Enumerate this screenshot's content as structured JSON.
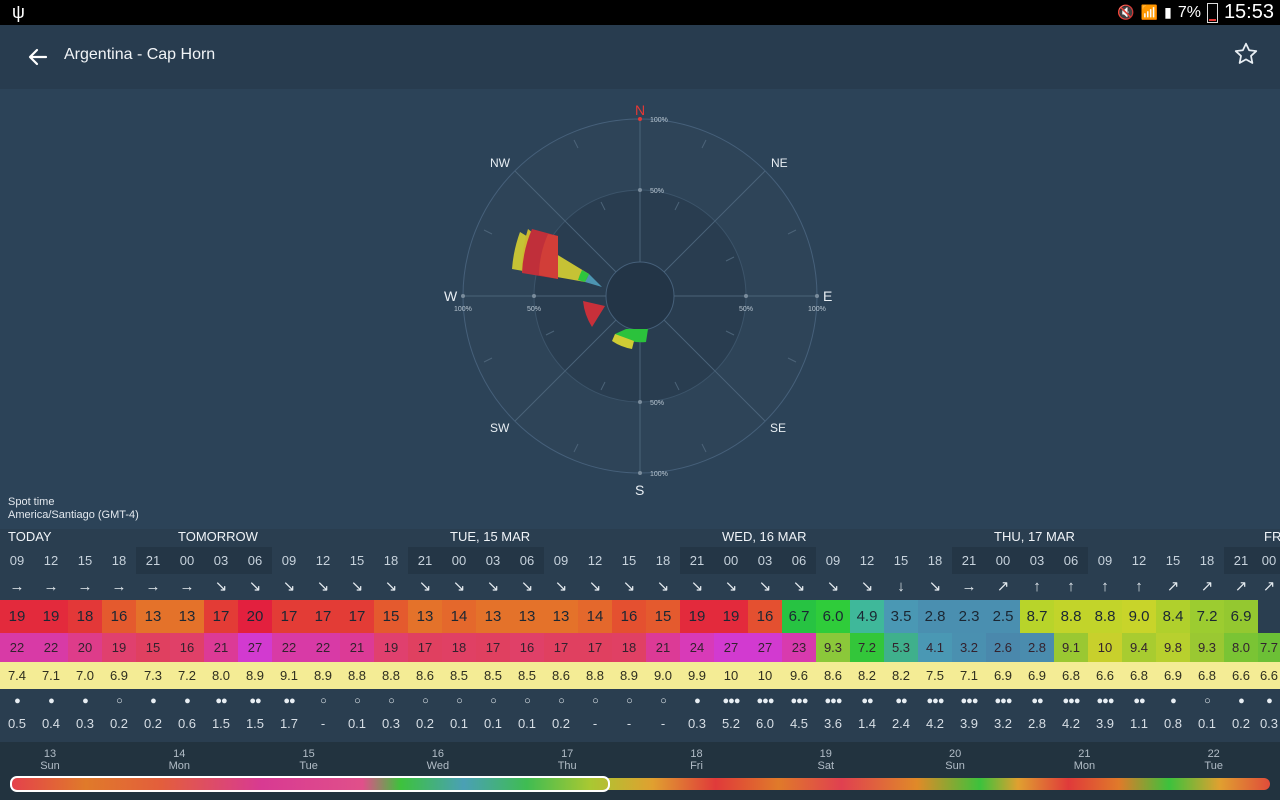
{
  "status_bar": {
    "usb_icon": "usb-icon",
    "battery_percent": "7%",
    "time": "15:53"
  },
  "app_bar": {
    "back_icon": "arrow-back-icon",
    "title": "Argentina - Cap Horn",
    "favorite_icon": "star-outline-icon"
  },
  "wind_rose": {
    "directions": [
      "N",
      "NE",
      "E",
      "SE",
      "S",
      "SW",
      "W",
      "NW"
    ],
    "ring_labels": [
      "100%",
      "50%"
    ],
    "colors": {
      "north": "#e53935",
      "ring": "#3a5268",
      "inner": "#2a3f53"
    }
  },
  "spot_time": {
    "label": "Spot time",
    "zone": "America/Santiago (GMT-4)"
  },
  "forecast": {
    "day_labels": [
      "TODAY",
      "TOMORROW",
      "TUE, 15 MAR",
      "WED, 16 MAR",
      "THU, 17 MAR",
      "FR"
    ],
    "hours": [
      "09",
      "12",
      "15",
      "18",
      "21",
      "00",
      "03",
      "06",
      "09",
      "12",
      "15",
      "18",
      "21",
      "00",
      "03",
      "06",
      "09",
      "12",
      "15",
      "18",
      "21",
      "00",
      "03",
      "06",
      "09",
      "12",
      "15",
      "18",
      "21",
      "00",
      "03",
      "06",
      "09",
      "12",
      "15",
      "18",
      "21",
      "00"
    ],
    "night_columns": [
      4,
      5,
      6,
      7,
      12,
      13,
      14,
      15,
      20,
      21,
      22,
      23,
      28,
      29,
      30,
      31,
      36,
      37
    ],
    "direction_arrows": [
      "→",
      "→",
      "→",
      "→",
      "→",
      "→",
      "↘",
      "↘",
      "↘",
      "↘",
      "↘",
      "↘",
      "↘",
      "↘",
      "↘",
      "↘",
      "↘",
      "↘",
      "↘",
      "↘",
      "↘",
      "↘",
      "↘",
      "↘",
      "↘",
      "↘",
      "↓",
      "↘",
      "→",
      "↗",
      "↑",
      "↑",
      "↑",
      "↑",
      "↗",
      "↗",
      "↗",
      "↗"
    ],
    "wind_speed": [
      "19",
      "19",
      "18",
      "16",
      "13",
      "13",
      "17",
      "20",
      "17",
      "17",
      "17",
      "15",
      "13",
      "14",
      "13",
      "13",
      "13",
      "14",
      "16",
      "15",
      "19",
      "19",
      "16",
      "6.7",
      "6.0",
      "4.9",
      "3.5",
      "2.8",
      "2.3",
      "2.5",
      "8.7",
      "8.8",
      "8.8",
      "9.0",
      "8.4",
      "7.2",
      "6.9"
    ],
    "wind_colors": [
      "#e32a3c",
      "#e32a3c",
      "#e33838",
      "#e45a2e",
      "#e4722a",
      "#e4722a",
      "#e33c36",
      "#e3203e",
      "#e33c36",
      "#e33c36",
      "#e33c36",
      "#e45a2e",
      "#e4722a",
      "#e4682c",
      "#e4722a",
      "#e4722a",
      "#e4722a",
      "#e4682c",
      "#e45030",
      "#e45a2e",
      "#e32a3c",
      "#e32a3c",
      "#e45030",
      "#27c342",
      "#2fcc3a",
      "#3fb89a",
      "#4a98b4",
      "#4a8fb0",
      "#4a8fb0",
      "#4a8fb0",
      "#b8d42a",
      "#c2d42a",
      "#c2d42a",
      "#c8d42a",
      "#b0d02c",
      "#9ccc30",
      "#94c830"
    ],
    "gusts": [
      "22",
      "22",
      "20",
      "19",
      "15",
      "16",
      "21",
      "27",
      "22",
      "22",
      "21",
      "19",
      "17",
      "18",
      "17",
      "16",
      "17",
      "17",
      "18",
      "21",
      "24",
      "27",
      "27",
      "23",
      "9.3",
      "7.2",
      "5.3",
      "4.1",
      "3.2",
      "2.6",
      "2.8",
      "9.1",
      "10",
      "9.4",
      "9.8",
      "9.3",
      "8.0",
      "7.7"
    ],
    "gust_colors": [
      "#d83aa6",
      "#d83aa6",
      "#de3c8a",
      "#e0406e",
      "#e04060",
      "#e04068",
      "#dc3a96",
      "#d23ad0",
      "#d83aa6",
      "#d83aa6",
      "#dc3a96",
      "#e0406e",
      "#e04060",
      "#e04064",
      "#e04060",
      "#e04068",
      "#e04060",
      "#e04060",
      "#e04064",
      "#dc3a96",
      "#d83ab8",
      "#d23ad0",
      "#d23ad0",
      "#d83aae",
      "#8bc83a",
      "#33c63a",
      "#3fb08c",
      "#4a98b4",
      "#4a90b0",
      "#4a88ac",
      "#4a8cae",
      "#9ac832",
      "#c8d02c",
      "#a8cc30",
      "#b8d02e",
      "#9ac832",
      "#7ac434",
      "#6cc036"
    ],
    "wave_period": [
      "7.4",
      "7.1",
      "7.0",
      "6.9",
      "7.3",
      "7.2",
      "8.0",
      "8.9",
      "9.1",
      "8.9",
      "8.8",
      "8.8",
      "8.6",
      "8.5",
      "8.5",
      "8.5",
      "8.6",
      "8.8",
      "8.9",
      "9.0",
      "9.9",
      "10",
      "10",
      "9.6",
      "8.6",
      "8.2",
      "8.2",
      "7.5",
      "7.1",
      "6.9",
      "6.9",
      "6.8",
      "6.6",
      "6.8",
      "6.9",
      "6.8",
      "6.6",
      "6.6",
      "6.6"
    ],
    "rain_drops": [
      "●",
      "●",
      "●",
      "○",
      "●",
      "●",
      "●●",
      "●●",
      "●●",
      "○",
      "○",
      "○",
      "○",
      "○",
      "○",
      "○",
      "○",
      "○",
      "○",
      "○",
      "●",
      "●●●",
      "●●●",
      "●●●",
      "●●●",
      "●●",
      "●●",
      "●●●",
      "●●●",
      "●●●",
      "●●",
      "●●●",
      "●●●",
      "●●",
      "●",
      "○",
      "●",
      "●"
    ],
    "precipitation": [
      "0.5",
      "0.4",
      "0.3",
      "0.2",
      "0.2",
      "0.6",
      "1.5",
      "1.5",
      "1.7",
      "-",
      "0.1",
      "0.3",
      "0.2",
      "0.1",
      "0.1",
      "0.1",
      "0.2",
      "-",
      "-",
      "-",
      "0.3",
      "5.2",
      "6.0",
      "4.5",
      "3.6",
      "1.4",
      "2.4",
      "4.2",
      "3.9",
      "3.2",
      "2.8",
      "4.2",
      "3.9",
      "1.1",
      "0.8",
      "0.1",
      "0.2",
      "0.3"
    ]
  },
  "timeline": {
    "days": [
      {
        "num": "13",
        "name": "Sun"
      },
      {
        "num": "14",
        "name": "Mon"
      },
      {
        "num": "15",
        "name": "Tue"
      },
      {
        "num": "16",
        "name": "Wed"
      },
      {
        "num": "17",
        "name": "Thu"
      },
      {
        "num": "18",
        "name": "Fri"
      },
      {
        "num": "19",
        "name": "Sat"
      },
      {
        "num": "20",
        "name": "Sun"
      },
      {
        "num": "21",
        "name": "Mon"
      },
      {
        "num": "22",
        "name": "Tue"
      }
    ]
  }
}
